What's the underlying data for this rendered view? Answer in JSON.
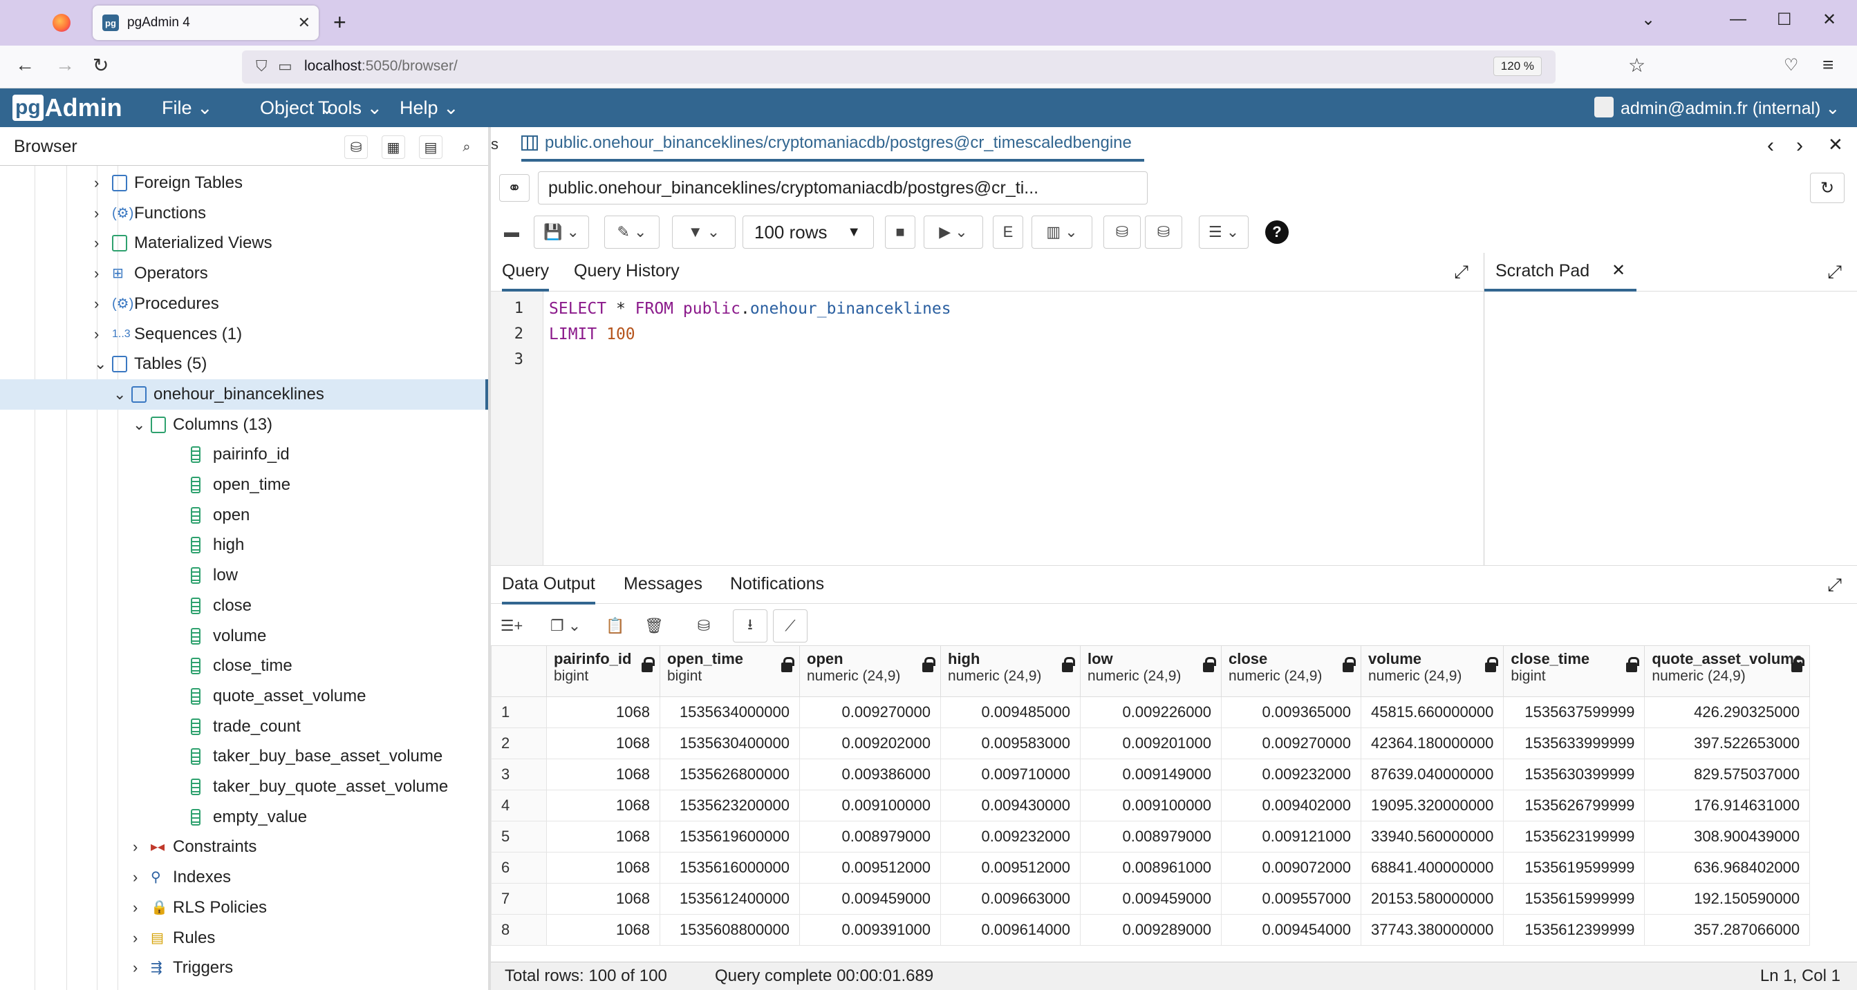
{
  "browser_window": {
    "tab_title": "pgAdmin 4",
    "url_host": "localhost",
    "url_path": ":5050/browser/",
    "zoom": "120 %"
  },
  "app": {
    "logo_pg": "pg",
    "logo_admin": "Admin",
    "menus": [
      "File",
      "Object",
      "Tools",
      "Help"
    ],
    "user": "admin@admin.fr (internal)"
  },
  "browser_panel": {
    "title": "Browser",
    "tree": [
      {
        "label": "Foreign Tables"
      },
      {
        "label": "Functions"
      },
      {
        "label": "Materialized Views"
      },
      {
        "label": "Operators"
      },
      {
        "label": "Procedures"
      },
      {
        "label": "Sequences (1)",
        "prefix": "1..3"
      },
      {
        "label": "Tables (5)"
      },
      {
        "label": "onehour_binanceklines"
      },
      {
        "label": "Columns (13)"
      },
      {
        "label": "pairinfo_id"
      },
      {
        "label": "open_time"
      },
      {
        "label": "open"
      },
      {
        "label": "high"
      },
      {
        "label": "low"
      },
      {
        "label": "close"
      },
      {
        "label": "volume"
      },
      {
        "label": "close_time"
      },
      {
        "label": "quote_asset_volume"
      },
      {
        "label": "trade_count"
      },
      {
        "label": "taker_buy_base_asset_volume"
      },
      {
        "label": "taker_buy_quote_asset_volume"
      },
      {
        "label": "empty_value"
      },
      {
        "label": "Constraints"
      },
      {
        "label": "Indexes"
      },
      {
        "label": "RLS Policies"
      },
      {
        "label": "Rules"
      },
      {
        "label": "Triggers"
      }
    ]
  },
  "query_tool": {
    "tab_prefix": "s",
    "tab_title": "public.onehour_binanceklines/cryptomaniacdb/postgres@cr_timescaledbengine",
    "connection": "public.onehour_binanceklines/cryptomaniacdb/postgres@cr_ti...",
    "rows_limit": "100 rows",
    "editor_tabs": [
      "Query",
      "Query History"
    ],
    "scratch_pad": "Scratch Pad",
    "line_numbers": [
      "1",
      "2",
      "3"
    ],
    "code": {
      "select": "SELECT",
      "star": " * ",
      "from": "FROM",
      "schema": " public",
      "dot": ".",
      "table": "onehour_binanceklines",
      "limit": "LIMIT",
      "limit_value": " 100"
    }
  },
  "results": {
    "tabs": [
      "Data Output",
      "Messages",
      "Notifications"
    ],
    "columns": [
      {
        "name": "pairinfo_id",
        "type": "bigint"
      },
      {
        "name": "open_time",
        "type": "bigint"
      },
      {
        "name": "open",
        "type": "numeric (24,9)"
      },
      {
        "name": "high",
        "type": "numeric (24,9)"
      },
      {
        "name": "low",
        "type": "numeric (24,9)"
      },
      {
        "name": "close",
        "type": "numeric (24,9)"
      },
      {
        "name": "volume",
        "type": "numeric (24,9)"
      },
      {
        "name": "close_time",
        "type": "bigint"
      },
      {
        "name": "quote_asset_volume",
        "type": "numeric (24,9)"
      }
    ],
    "rows": [
      {
        "n": "1",
        "cells": [
          "1068",
          "1535634000000",
          "0.009270000",
          "0.009485000",
          "0.009226000",
          "0.009365000",
          "45815.660000000",
          "1535637599999",
          "426.290325000"
        ]
      },
      {
        "n": "2",
        "cells": [
          "1068",
          "1535630400000",
          "0.009202000",
          "0.009583000",
          "0.009201000",
          "0.009270000",
          "42364.180000000",
          "1535633999999",
          "397.522653000"
        ]
      },
      {
        "n": "3",
        "cells": [
          "1068",
          "1535626800000",
          "0.009386000",
          "0.009710000",
          "0.009149000",
          "0.009232000",
          "87639.040000000",
          "1535630399999",
          "829.575037000"
        ]
      },
      {
        "n": "4",
        "cells": [
          "1068",
          "1535623200000",
          "0.009100000",
          "0.009430000",
          "0.009100000",
          "0.009402000",
          "19095.320000000",
          "1535626799999",
          "176.914631000"
        ]
      },
      {
        "n": "5",
        "cells": [
          "1068",
          "1535619600000",
          "0.008979000",
          "0.009232000",
          "0.008979000",
          "0.009121000",
          "33940.560000000",
          "1535623199999",
          "308.900439000"
        ]
      },
      {
        "n": "6",
        "cells": [
          "1068",
          "1535616000000",
          "0.009512000",
          "0.009512000",
          "0.008961000",
          "0.009072000",
          "68841.400000000",
          "1535619599999",
          "636.968402000"
        ]
      },
      {
        "n": "7",
        "cells": [
          "1068",
          "1535612400000",
          "0.009459000",
          "0.009663000",
          "0.009459000",
          "0.009557000",
          "20153.580000000",
          "1535615999999",
          "192.150590000"
        ]
      },
      {
        "n": "8",
        "cells": [
          "1068",
          "1535608800000",
          "0.009391000",
          "0.009614000",
          "0.009289000",
          "0.009454000",
          "37743.380000000",
          "1535612399999",
          "357.287066000"
        ]
      }
    ],
    "status_rows": "Total rows: 100 of 100",
    "status_query": "Query complete 00:00:01.689",
    "cursor": "Ln 1, Col 1"
  }
}
